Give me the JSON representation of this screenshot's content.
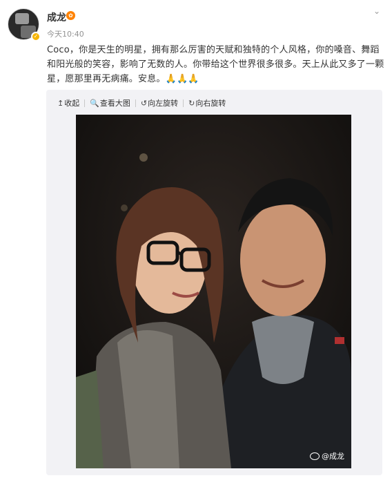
{
  "post": {
    "author": "成龙",
    "vip_badge": "✿",
    "time": "今天10:40",
    "text": "Coco，你是天生的明星，拥有那么厉害的天赋和独特的个人风格，你的嗓音、舞蹈和阳光般的笑容，影响了无数的人。你带给这个世界很多很多。天上从此又多了一颗星，愿那里再无病痛。安息。🙏🙏🙏"
  },
  "toolbar": {
    "collapse_icon": "↥",
    "collapse": "收起",
    "zoom_icon": "🔍",
    "view_large": "查看大图",
    "rotate_left_icon": "↺",
    "rotate_left": "向左旋转",
    "rotate_right_icon": "↻",
    "rotate_right": "向右旋转"
  },
  "photo": {
    "watermark": "@成龙"
  },
  "icons": {
    "expand": "chevron-down-icon",
    "verify": "verified-badge-icon"
  },
  "colors": {
    "accent": "#ff8200",
    "verify": "#f7b500",
    "muted": "#939393",
    "media_bg": "#f2f2f5"
  }
}
